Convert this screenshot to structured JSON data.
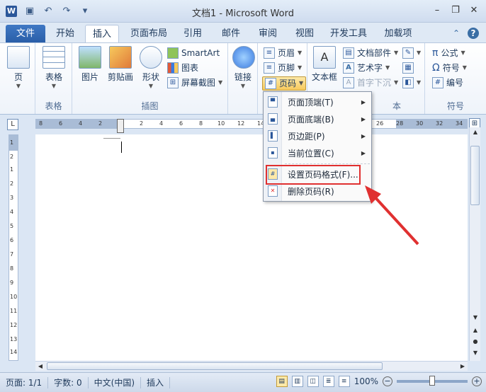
{
  "window": {
    "app_icon": "W",
    "title": "文档1 - Microsoft Word",
    "qat": [
      "save-icon",
      "undo-icon",
      "redo-icon",
      "customize-icon"
    ],
    "controls": [
      "minimize-icon",
      "restore-icon",
      "close-icon"
    ]
  },
  "tabs": {
    "file": "文件",
    "items": [
      "开始",
      "插入",
      "页面布局",
      "引用",
      "邮件",
      "审阅",
      "视图",
      "开发工具",
      "加载项"
    ],
    "active": "插入"
  },
  "ribbon": {
    "pages": "页",
    "table": "表格",
    "group_table": "表格",
    "picture": "图片",
    "clipart": "剪贴画",
    "shapes": "形状",
    "smartart": "SmartArt",
    "chart": "图表",
    "screenshot": "屏幕截图",
    "group_illustration": "插图",
    "link": "链接",
    "header": "页眉",
    "footer": "页脚",
    "pagenum": "页码",
    "textbox": "文本框",
    "docparts": "文档部件",
    "wordart": "艺术字",
    "dropcap": "首字下沉",
    "group_text_partial": "本",
    "formula": "公式",
    "symbol": "符号",
    "number": "编号",
    "group_symbol": "符号"
  },
  "ruler": {
    "corner": "L",
    "ticks": [
      "8",
      "6",
      "4",
      "2",
      "2",
      "4",
      "6",
      "8",
      "10",
      "12",
      "14",
      "26",
      "28",
      "30",
      "32",
      "34"
    ],
    "vticks": [
      "1",
      "2",
      "1",
      "2",
      "3",
      "4",
      "5",
      "6",
      "7",
      "8",
      "9",
      "10",
      "11",
      "12",
      "13",
      "14"
    ]
  },
  "menu": {
    "items": [
      {
        "label": "页面顶端(T)",
        "submenu": true
      },
      {
        "label": "页面底端(B)",
        "submenu": true
      },
      {
        "label": "页边距(P)",
        "submenu": true
      },
      {
        "label": "当前位置(C)",
        "submenu": true
      },
      {
        "label": "设置页码格式(F)...",
        "submenu": false
      },
      {
        "label": "删除页码(R)",
        "submenu": false
      }
    ]
  },
  "status": {
    "page": "页面: 1/1",
    "words": "字数: 0",
    "language": "中文(中国)",
    "mode": "插入",
    "zoom": "100%"
  },
  "colors": {
    "accent": "#2b579a",
    "highlight": "#e03030"
  }
}
